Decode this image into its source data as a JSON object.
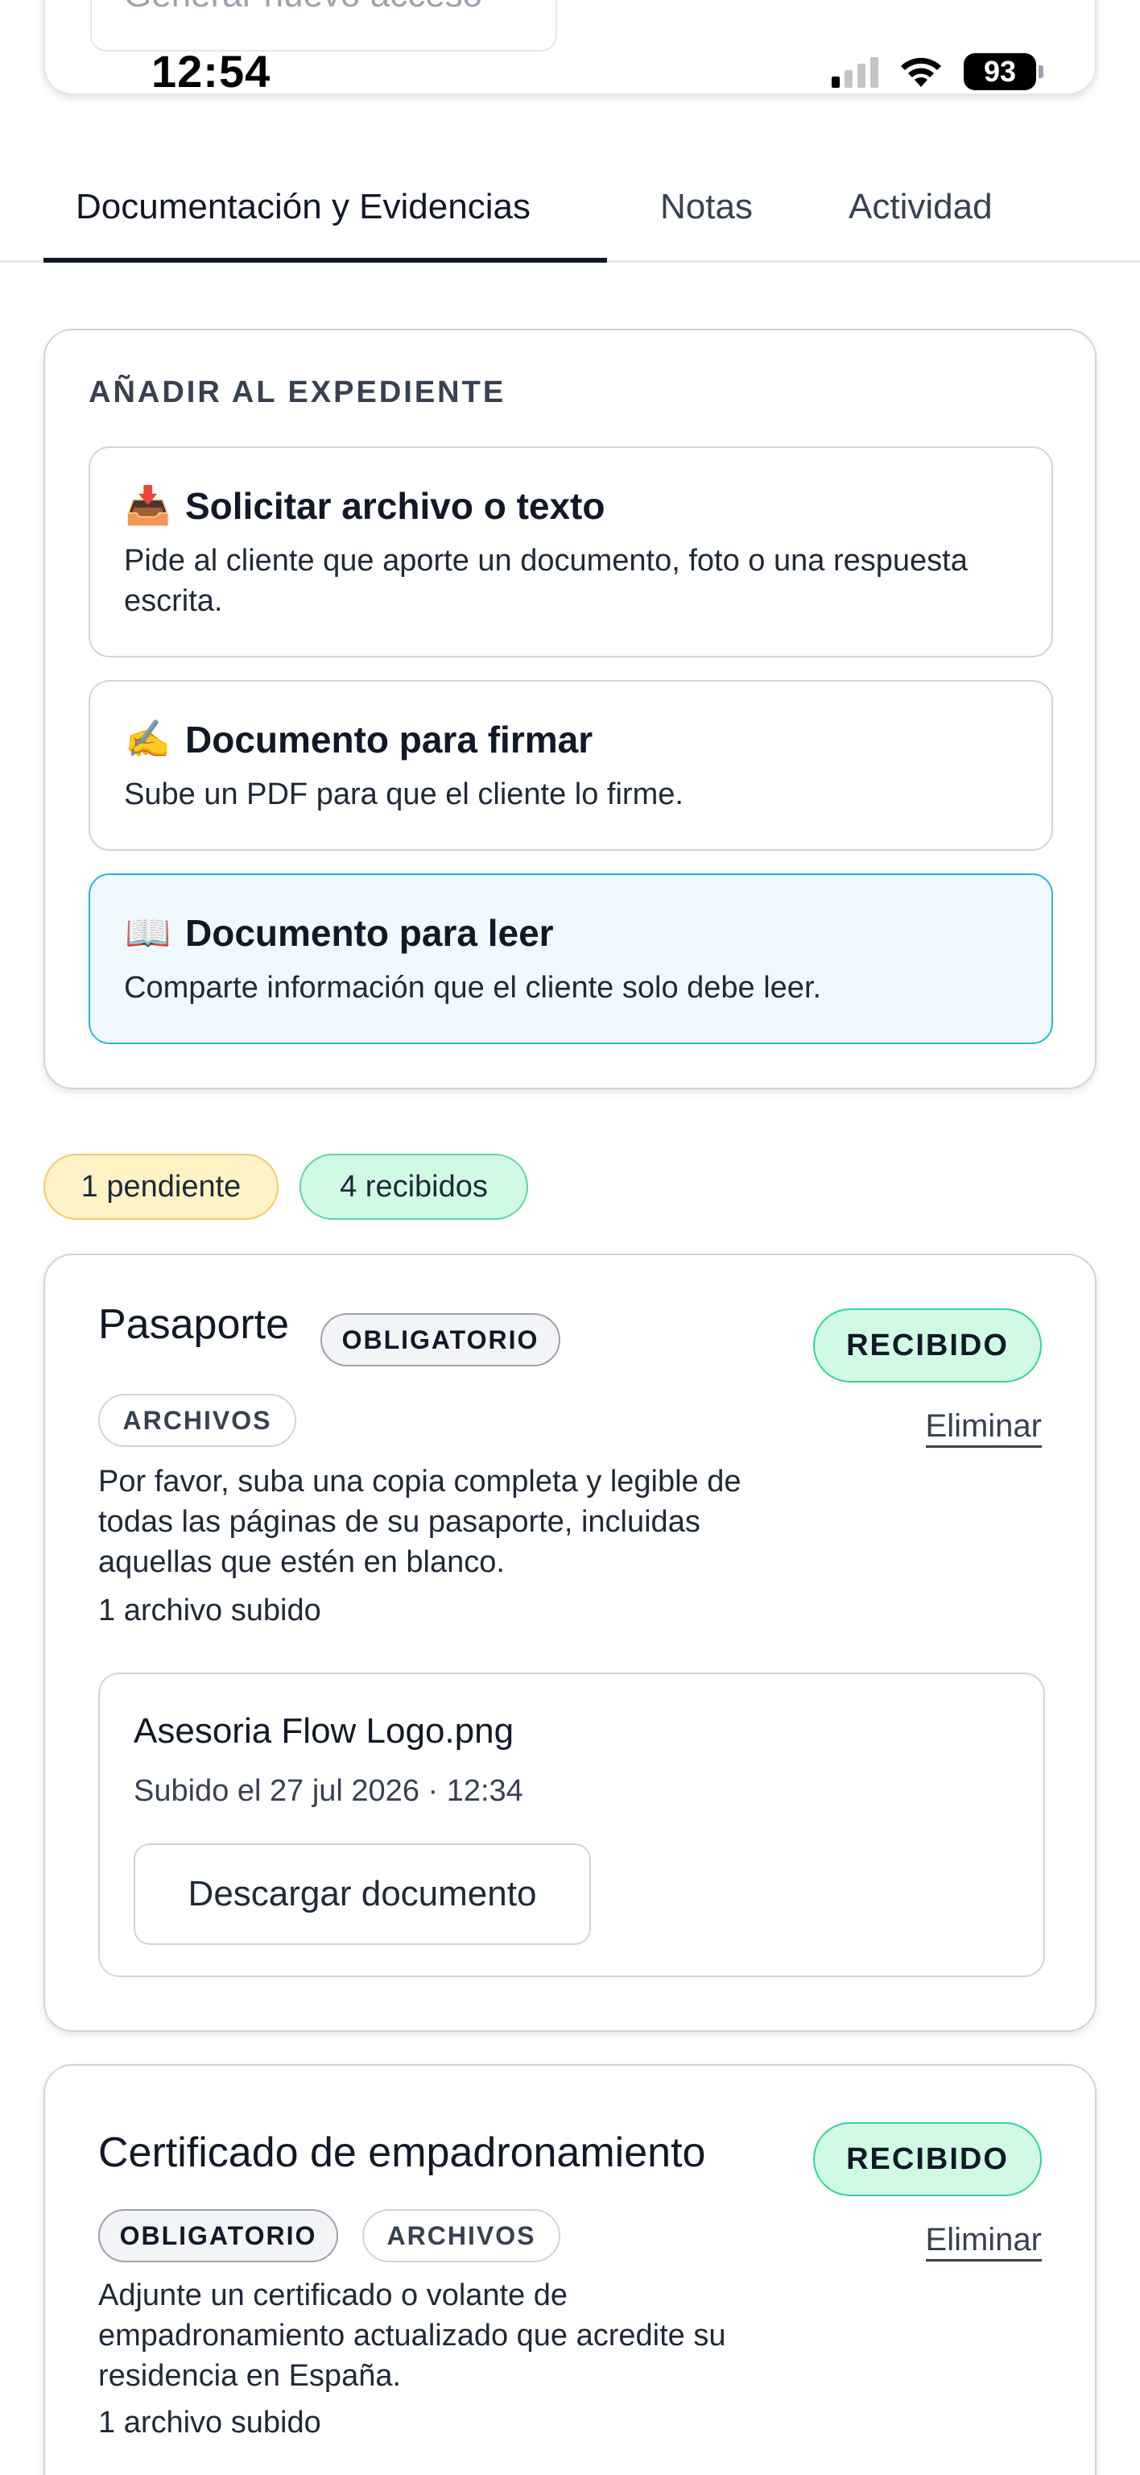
{
  "status_bar": {
    "time": "12:54",
    "battery": "93"
  },
  "top_card": {
    "new_access_button": "Generar nuevo acceso"
  },
  "tabs": [
    {
      "label": "Documentación y Evidencias",
      "active": true
    },
    {
      "label": "Notas",
      "active": false
    },
    {
      "label": "Actividad",
      "active": false
    }
  ],
  "add_section": {
    "title": "AÑADIR AL EXPEDIENTE",
    "options": [
      {
        "emoji": "📥",
        "title": "Solicitar archivo o texto",
        "description": "Pide al cliente que aporte un documento, foto o una respuesta escrita."
      },
      {
        "emoji": "✍️",
        "title": "Documento para firmar",
        "description": "Sube un PDF para que el cliente lo firme."
      },
      {
        "emoji": "📖",
        "title": "Documento para leer",
        "description": "Comparte información que el cliente solo debe leer."
      }
    ]
  },
  "counts": {
    "pending": "1 pendiente",
    "received": "4 recibidos"
  },
  "documents": [
    {
      "title": "Pasaporte",
      "tags": [
        "OBLIGATORIO",
        "ARCHIVOS"
      ],
      "status": "RECIBIDO",
      "delete_label": "Eliminar",
      "description": "Por favor, suba una copia completa y legible de todas las páginas de su pasaporte, incluidas aquellas que estén en blanco.",
      "count": "1 archivo subido",
      "file": {
        "name": "Asesoria Flow Logo.png",
        "date": "Subido el 27 jul 2026 · 12:34",
        "download_label": "Descargar documento"
      }
    },
    {
      "title": "Certificado de empadronamiento",
      "tags": [
        "OBLIGATORIO",
        "ARCHIVOS"
      ],
      "status": "RECIBIDO",
      "delete_label": "Eliminar",
      "description": "Adjunte un certificado o volante de empadronamiento actualizado que acredite su residencia en España.",
      "count": "1 archivo subido"
    }
  ],
  "colors": {
    "accent_selected_border": "#22b8d8",
    "received_green": "#d1fae5",
    "pending_yellow": "#fef3c7"
  }
}
